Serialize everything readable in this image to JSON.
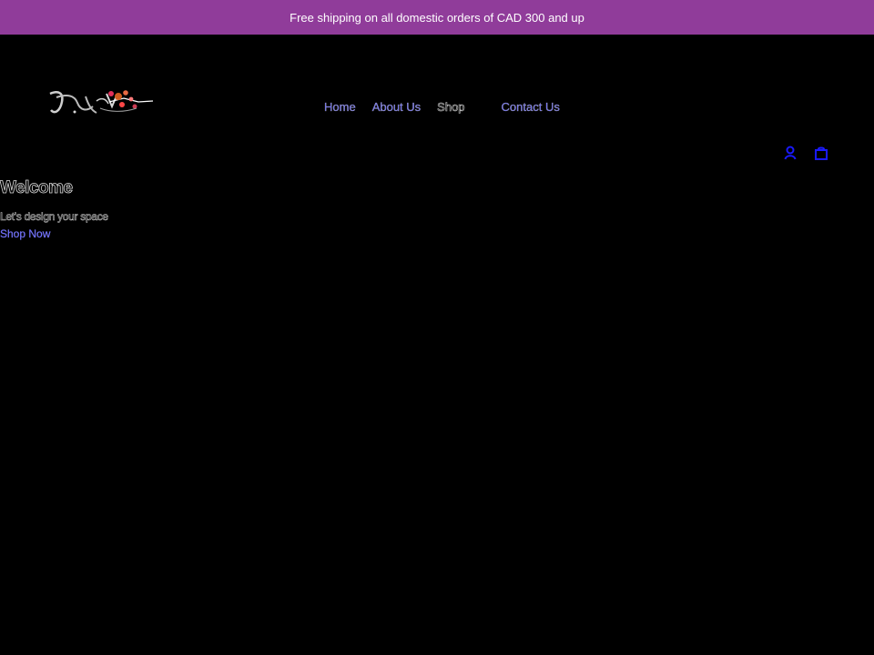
{
  "announcement": {
    "text": "Free shipping on all domestic orders of CAD 300 and up"
  },
  "header": {
    "logo_text": "Vu Art",
    "nav": {
      "home": "Home",
      "about": "About Us",
      "shop": "Shop",
      "contact": "Contact Us"
    },
    "icons": {
      "account": "account-icon",
      "cart": "cart-icon"
    }
  },
  "hero": {
    "title": "Welcome",
    "subtitle": "Let's design your space",
    "cta": "Shop Now"
  },
  "colors": {
    "announcement_bg": "#903c9a",
    "page_bg": "#000000",
    "link": "#6b6bff",
    "icon_blue": "#1a1aff"
  }
}
